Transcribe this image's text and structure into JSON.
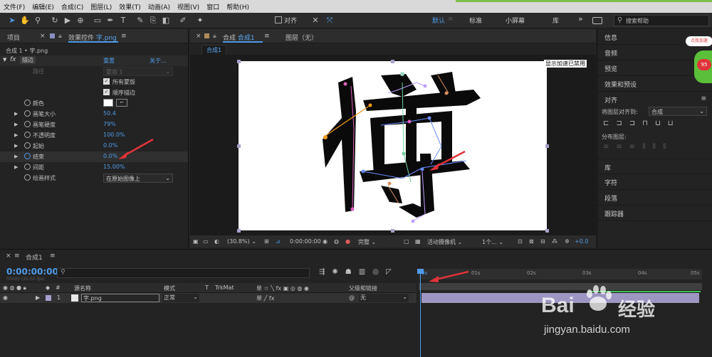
{
  "menu": [
    "文件(F)",
    "编辑(E)",
    "合成(C)",
    "图层(L)",
    "效果(T)",
    "动画(A)",
    "视图(V)",
    "窗口",
    "帮助(H)"
  ],
  "toolbar": {
    "align_label": "对齐",
    "workspaces": [
      "默认",
      "标准",
      "小屏幕",
      "库"
    ],
    "more": "»",
    "search_placeholder": "搜索帮助"
  },
  "left_panel": {
    "tab_project": "项目",
    "tab_effects_prefix": "效果控件",
    "tab_effects_file": "字.png",
    "breadcrumb": "合成 1 • 字.png",
    "effect_name": "描边",
    "effect_reset": "重置",
    "effect_about": "关于...",
    "properties": [
      {
        "label": "路径",
        "value": "蒙版 1",
        "kind": "dim"
      },
      {
        "label": "",
        "value": "所有蒙版",
        "kind": "check"
      },
      {
        "label": "",
        "value": "顺序描边",
        "kind": "check"
      },
      {
        "label": "颜色",
        "value": "",
        "kind": "color"
      },
      {
        "label": "画笔大小",
        "value": "50.4",
        "kind": "num"
      },
      {
        "label": "画笔硬度",
        "value": "79%",
        "kind": "num"
      },
      {
        "label": "不透明度",
        "value": "100.0%",
        "kind": "num"
      },
      {
        "label": "起始",
        "value": "0.0%",
        "kind": "num"
      },
      {
        "label": "结束",
        "value": "0.0%",
        "kind": "num"
      },
      {
        "label": "间距",
        "value": "15.00%",
        "kind": "num"
      },
      {
        "label": "绘画样式",
        "value": "在原始图像上",
        "kind": "dropdown"
      }
    ]
  },
  "comp_panel": {
    "tab_comp_prefix": "合成",
    "tab_comp_name": "合成1",
    "tab_layer": "图层（无）",
    "sub_tab": "合成1",
    "gpu_notice": "显示加速已禁用",
    "zoom": "(30.8%)",
    "timecode": "0:00:00:00",
    "resolution": "完整",
    "camera": "活动摄像机",
    "views": "1个...",
    "exposure": "+0.0"
  },
  "right_panel": {
    "items": [
      "信息",
      "音频",
      "预览",
      "效果和预设",
      "对齐"
    ],
    "align_to_label": "将图层对齐到:",
    "align_to_value": "合成",
    "distribute_label": "分布图层:",
    "lower_items": [
      "库",
      "字符",
      "段落",
      "跟踪器"
    ]
  },
  "timeline": {
    "tab": "合成1",
    "timecode": "0:00:00:00",
    "frames": "00000 (25.00 fps)",
    "col_source": "源名称",
    "col_mode": "模式",
    "col_t": "T",
    "col_trkmat": "TrkMat",
    "col_parent": "父级和链接",
    "layer_number": "1",
    "layer_name": "字.png",
    "layer_mode": "正常",
    "layer_parent": "无",
    "ruler_ticks": [
      "0s",
      "01s",
      "02s",
      "03s",
      "04s",
      "05s"
    ],
    "playhead_fraction": 0.0
  },
  "watermark": {
    "brand": "Bai",
    "brand_cn": "经验",
    "url": "jingyan.baidu.com",
    "badge": "点我加速",
    "badge_number": "95"
  },
  "colors": {
    "accent": "#4f9be8",
    "annotation_arrow": "#e0333a",
    "layer_bar": "#9e96c2"
  }
}
